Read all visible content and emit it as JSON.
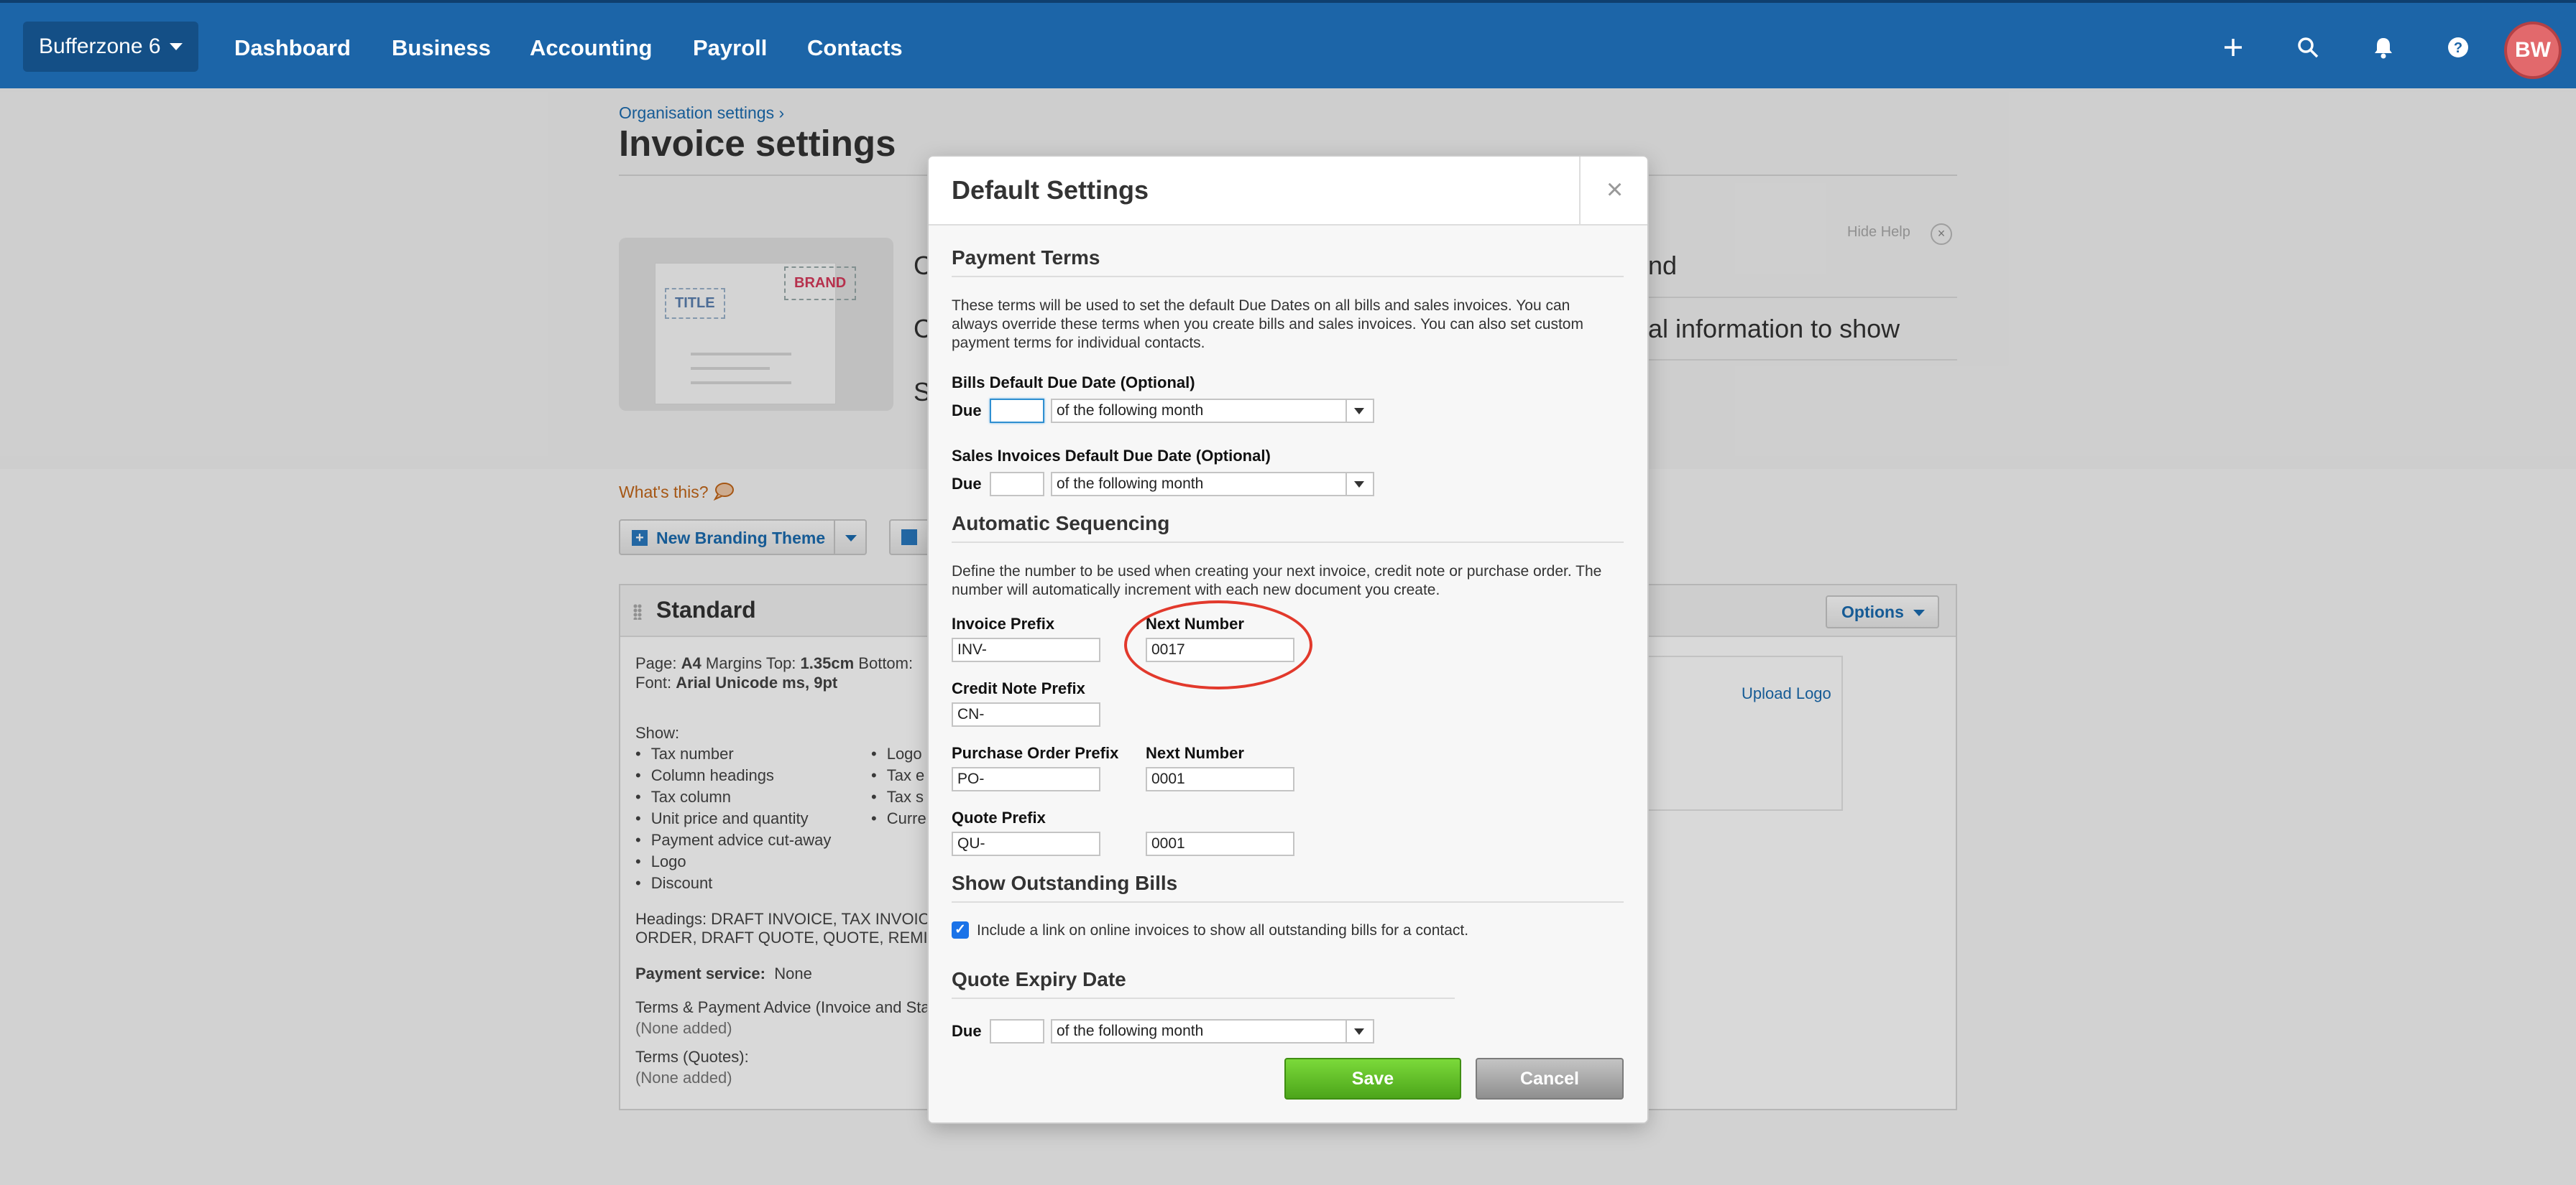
{
  "nav": {
    "org_name": "Bufferzone 6",
    "items": [
      "Dashboard",
      "Business",
      "Accounting",
      "Payroll",
      "Contacts"
    ],
    "avatar_initials": "BW",
    "colors": {
      "bar": "#1c65a8",
      "avatar": "#e2696c"
    }
  },
  "page": {
    "breadcrumb": "Organisation settings ›",
    "title": "Invoice settings",
    "help_lines": [
      "C",
      "C",
      "S"
    ],
    "help_right": [
      "nd",
      "al information to show"
    ],
    "hide_help": "Hide Help",
    "whats_this": "What's this?",
    "new_branding_theme": "New Branding Theme",
    "brand_preview": {
      "title_tag": "TITLE",
      "brand_tag": "BRAND"
    }
  },
  "theme_card": {
    "title": "Standard",
    "options_label": "Options",
    "page_label": "Page:",
    "page_size": "A4",
    "margins_label": "Margins Top:",
    "margin_top": "1.35cm",
    "bottom_label": "Bottom:",
    "font_label": "Font:",
    "font_value": "Arial Unicode ms, 9pt",
    "show_label": "Show:",
    "show_left": [
      "Tax number",
      "Column headings",
      "Tax column",
      "Unit price and quantity",
      "Payment advice cut-away",
      "Logo",
      "Discount"
    ],
    "show_right": [
      "Logo",
      "Tax e",
      "Tax s",
      "Curre"
    ],
    "headings_line1": "Headings: DRAFT INVOICE, TAX INVOICE",
    "headings_line2": "ORDER, DRAFT QUOTE, QUOTE, REMITTA",
    "payment_service_label": "Payment service:",
    "payment_service_value": "None",
    "terms_label": "Terms & Payment Advice (Invoice and Sta",
    "terms_value": "(None added)",
    "terms_quotes_label": "Terms (Quotes):",
    "terms_quotes_value": "(None added)",
    "upload_logo": "Upload Logo"
  },
  "modal": {
    "title": "Default Settings",
    "close_icon": "×",
    "payment_terms": {
      "heading": "Payment Terms",
      "description": "These terms will be used to set the default Due Dates on all bills and sales invoices. You can always override these terms when you create bills and sales invoices. You can also set custom payment terms for individual contacts.",
      "bills_label": "Bills Default Due Date (Optional)",
      "sales_label": "Sales Invoices Default Due Date (Optional)",
      "due_label": "Due",
      "bills_due_value": "",
      "sales_due_value": "",
      "select_value": "of the following month"
    },
    "sequencing": {
      "heading": "Automatic Sequencing",
      "description": "Define the number to be used when creating your next invoice, credit note or purchase order. The number will automatically increment with each new document you create.",
      "invoice_prefix_label": "Invoice Prefix",
      "invoice_prefix": "INV-",
      "next_number_label": "Next Number",
      "invoice_next": "0017",
      "credit_note_prefix_label": "Credit Note Prefix",
      "credit_note_prefix": "CN-",
      "po_prefix_label": "Purchase Order Prefix",
      "po_prefix": "PO-",
      "po_next_label": "Next Number",
      "po_next": "0001",
      "quote_prefix_label": "Quote Prefix",
      "quote_prefix": "QU-",
      "quote_next": "0001"
    },
    "outstanding": {
      "heading": "Show Outstanding Bills",
      "checkbox_label": "Include a link on online invoices to show all outstanding bills for a contact.",
      "checked": true
    },
    "quote_expiry": {
      "heading": "Quote Expiry Date",
      "due_label": "Due",
      "due_value": "",
      "select_value": "of the following month"
    },
    "save_label": "Save",
    "cancel_label": "Cancel",
    "colors": {
      "save": "#5cb82a",
      "cancel": "#a8a8a8",
      "highlight_ring": "#e2392c"
    }
  }
}
